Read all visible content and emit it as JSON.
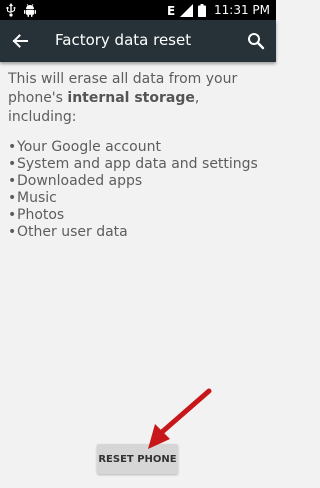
{
  "status_bar": {
    "time": "11:31 PM",
    "icons": [
      "usb-icon",
      "android-icon",
      "lte-icon",
      "signal-icon",
      "battery-icon"
    ],
    "lte_label": "E"
  },
  "app_bar": {
    "title": "Factory data reset",
    "back_icon": "back-arrow-icon",
    "search_icon": "search-icon",
    "background": "#263238"
  },
  "content": {
    "intro_prefix": "This will erase all data from your phone's ",
    "intro_bold": "internal storage",
    "intro_suffix": ", including:",
    "items": [
      {
        "bullet": "•",
        "label": "Your Google account"
      },
      {
        "bullet": "•",
        "label": "System and app data and settings"
      },
      {
        "bullet": "•",
        "label": "Downloaded apps"
      },
      {
        "bullet": "•",
        "label": "Music"
      },
      {
        "bullet": "•",
        "label": "Photos"
      },
      {
        "bullet": "•",
        "label": "Other user data"
      }
    ]
  },
  "actions": {
    "reset_label": "RESET PHONE"
  },
  "annotation": {
    "arrow_color": "#c8171b"
  }
}
